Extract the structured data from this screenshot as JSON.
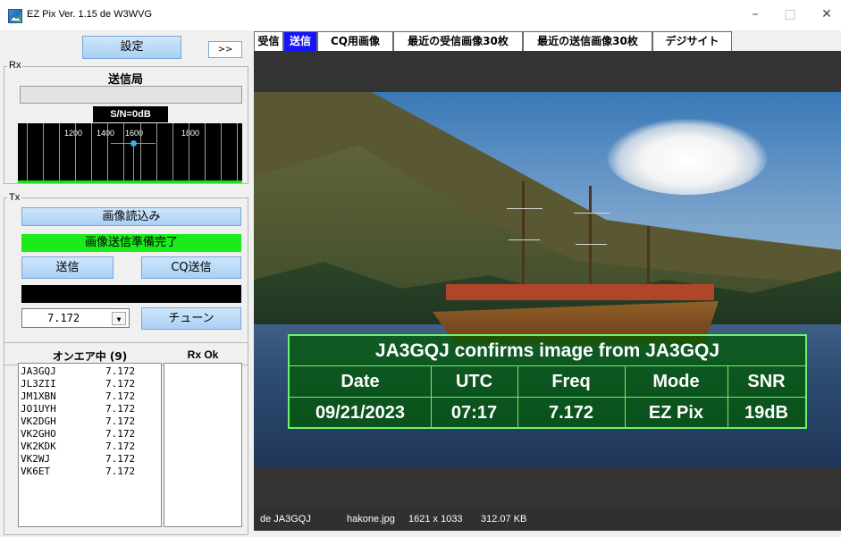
{
  "window": {
    "title": "EZ Pix   Ver. 1.15 de W3WVG",
    "minimize": "–",
    "maximize": "□",
    "close": "✕"
  },
  "left": {
    "settings_button": "設定",
    "expand_button": ">>",
    "rx": {
      "label": "Rx",
      "station_header": "送信局",
      "station_value": "",
      "sn_readout": "S/N=0dB",
      "spectrum_ticks": [
        "1200",
        "1400",
        "1600",
        "1800"
      ]
    },
    "tx": {
      "label": "Tx",
      "load_image_button": "画像読込み",
      "status_text": "画像送信準備完了",
      "send_button": "送信",
      "cq_send_button": "CQ送信",
      "frequency": "7.172",
      "tune_button": "チューン"
    },
    "onair": {
      "header": "オンエア中 (9)",
      "rxok_header": "Rx Ok",
      "stations": [
        {
          "call": "JA3GQJ",
          "freq": "7.172"
        },
        {
          "call": "JL3ZII",
          "freq": "7.172"
        },
        {
          "call": "JM1XBN",
          "freq": "7.172"
        },
        {
          "call": "JO1UYH",
          "freq": "7.172"
        },
        {
          "call": "VK2DGH",
          "freq": "7.172"
        },
        {
          "call": "VK2GHO",
          "freq": "7.172"
        },
        {
          "call": "VK2KDK",
          "freq": "7.172"
        },
        {
          "call": "VK2WJ",
          "freq": "7.172"
        },
        {
          "call": "VK6ET",
          "freq": "7.172"
        }
      ]
    }
  },
  "tabs": [
    {
      "label": "受信",
      "active": false
    },
    {
      "label": "送信",
      "active": true
    },
    {
      "label": "CQ用画像",
      "active": false
    },
    {
      "label": "最近の受信画像30枚",
      "active": false
    },
    {
      "label": "最近の送信画像30枚",
      "active": false
    },
    {
      "label": "デジサイト",
      "active": false
    }
  ],
  "image": {
    "confirm_title": "JA3GQJ confirms image from JA3GQJ",
    "headers": [
      "Date",
      "UTC",
      "Freq",
      "Mode",
      "SNR"
    ],
    "values": [
      "09/21/2023",
      "07:17",
      "7.172",
      "EZ Pix",
      "19dB"
    ]
  },
  "statusbar": {
    "de": "de JA3GQJ",
    "file": "hakone.jpg",
    "dimensions": "1621 x 1033",
    "size": "312.07 KB"
  },
  "colors": {
    "status_green": "#1aeb1a",
    "active_tab": "#1414ff",
    "spectrum_marker": "#37b3e6"
  }
}
